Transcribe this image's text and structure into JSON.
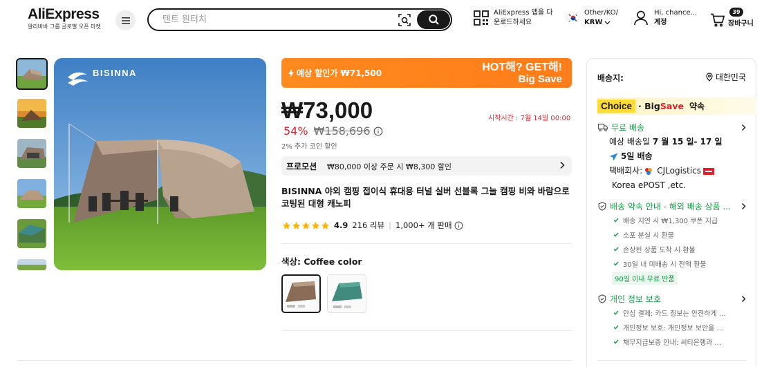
{
  "header": {
    "logo_text": "AliExpress",
    "logo_subtitle": "알리바바 그룹 글로벌 오픈 마켓",
    "search_placeholder": "텐트 원터치",
    "app_download_line1": "AliExpress 앱을 다",
    "app_download_line2": "운로드하세요",
    "region_line1": "Other/KO/",
    "region_line2": "KRW",
    "account_line1": "Hi, chance...",
    "account_line2": "계정",
    "cart_count": "39",
    "cart_label": "장바구니"
  },
  "gallery": {
    "brand_logo": "BISINNA"
  },
  "deal_banner": {
    "expected_discount": "예상 할인가 ₩71,500",
    "hot_line1": "HOT해? GET해!",
    "hot_line2": "Big Save"
  },
  "pricing": {
    "price": "₩73,000",
    "start_time": "시작시간 :  7월 14일 00:00",
    "discount": "54%",
    "original_price": "₩158,696",
    "coin_note": "2% 추가 코인 할인"
  },
  "promotion": {
    "tag": "프로모션",
    "text": "₩80,000 이상 주문 시 ₩8,300 할인"
  },
  "product": {
    "title": "BISINNA 야외 캠핑 접이식 휴대용 터널 실버 선블록 그늘 캠핑 비와 바람으로 코팅된 대형 캐노피",
    "rating": "4.9",
    "reviews": "216 리뷰",
    "sold": "1,000+ 개 판매",
    "rating_stars": 5
  },
  "color": {
    "label": "색상: Coffee color",
    "selected_index": 0
  },
  "shipping": {
    "ship_to_label": "배송지:",
    "ship_to_value": "대한민국",
    "choice_tag": "Choice",
    "choice_big": "· Big ",
    "choice_save": "Save",
    "choice_promise": "약속",
    "free_shipping": "무료 배송",
    "est_prefix": "예상 배송일 ",
    "est_dates": "7 월 15 일- 17 일",
    "days_label": "5일 배송",
    "carrier_prefix": "택배회사: ",
    "carrier_1": "CJLogistics",
    "carrier_2": "Korea ePOST ,etc.",
    "commitment_title": "배송 약속 안내 - 해외 배송 상품 ...",
    "commitment_items": [
      "배송 지연 시 ₩1,300 쿠폰 지급",
      "소포 분실 시 환불",
      "손상된 상품 도착 시 환불",
      "30일 내 미배송 시 전액 환불"
    ],
    "free_return": "90일 이내 무료 반품",
    "privacy_title": "개인 정보 보호",
    "privacy_items": [
      "안심 결제: 카드 정보는 안전하게 ...",
      "개인정보 보호: 개인정보 보안을 ...",
      "채무지급보증 안내: 씨티은행과 ..."
    ]
  },
  "colors": {
    "accent_orange": "#ff8a1f",
    "price_red": "#e5202e",
    "green": "#1a9e4a",
    "star": "#ffb400"
  }
}
